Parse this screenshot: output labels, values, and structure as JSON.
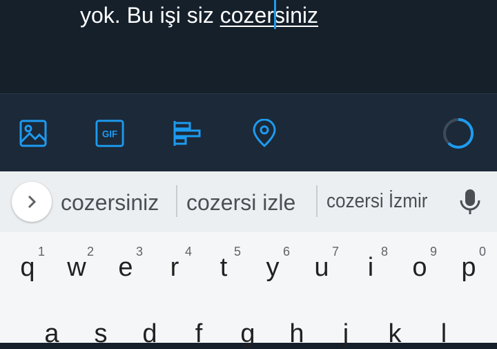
{
  "compose": {
    "text_before": "yok. Bu işi siz ",
    "underlined_left": "cozer",
    "underlined_right": "siniz"
  },
  "toolbar": {
    "icons": [
      "image-icon",
      "gif-icon",
      "poll-icon",
      "location-icon"
    ],
    "gif_label": "GIF",
    "accent": "#1d9bf0"
  },
  "suggestions": {
    "items": [
      "cozersiniz",
      "cozersi izle",
      "cozersi İzmir"
    ]
  },
  "keyboard": {
    "row1": [
      {
        "key": "q",
        "hint": "1"
      },
      {
        "key": "w",
        "hint": "2"
      },
      {
        "key": "e",
        "hint": "3"
      },
      {
        "key": "r",
        "hint": "4"
      },
      {
        "key": "t",
        "hint": "5"
      },
      {
        "key": "y",
        "hint": "6"
      },
      {
        "key": "u",
        "hint": "7"
      },
      {
        "key": "i",
        "hint": "8"
      },
      {
        "key": "o",
        "hint": "9"
      },
      {
        "key": "p",
        "hint": "0"
      }
    ],
    "row2": [
      "a",
      "s",
      "d",
      "f",
      "g",
      "h",
      "j",
      "k",
      "l"
    ]
  }
}
